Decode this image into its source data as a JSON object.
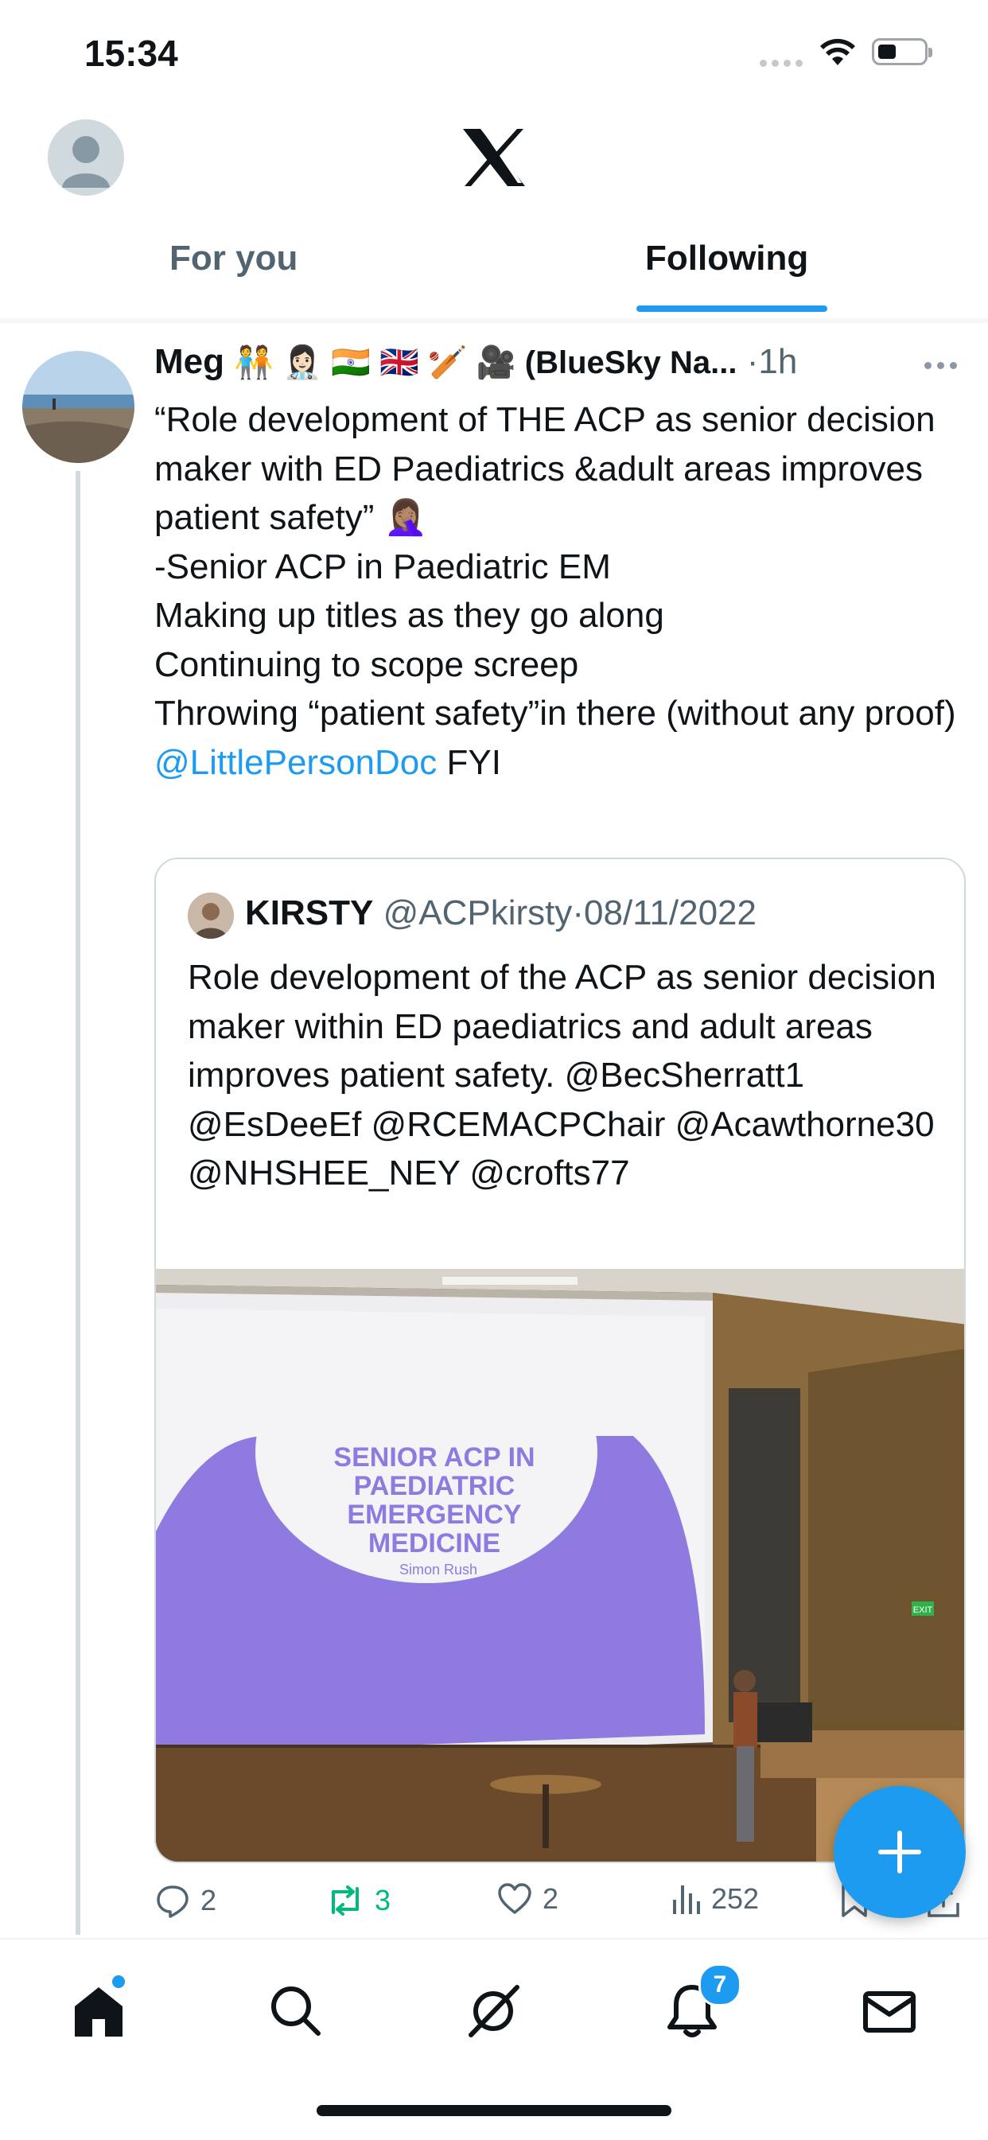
{
  "status_bar": {
    "time": "15:34"
  },
  "header": {
    "tabs": [
      {
        "label": "For you",
        "active": false
      },
      {
        "label": "Following",
        "active": true
      }
    ]
  },
  "tweet": {
    "name": "Meg",
    "name_suffix": "🧑‍🤝‍🧑 👩🏻‍⚕️ 🇮🇳 🇬🇧 🏏 🎥 (BlueSky Na...",
    "dot": "·",
    "time": "1h",
    "body_lines": [
      "“Role development of THE ACP as senior decision maker with ED Paediatrics &adult areas improves patient safety” 🤦🏽‍♀️",
      "-Senior ACP in Paediatric EM",
      "Making up titles as they go along",
      "Continuing to scope screep",
      "Throwing “patient safety”in there (without any proof)"
    ],
    "mention": "@LittlePersonDoc",
    "mention_suffix": " FYI",
    "quote": {
      "name": "KIRSTY",
      "handle": "@ACPkirsty",
      "dot": "·",
      "date": "08/11/2022",
      "body": "Role development of the ACP as senior decision maker within ED paediatrics and adult areas improves patient safety. @BecSherratt1 @EsDeeEf @RCEMACPChair @Acawthorne30 @NHSHEE_NEY @crofts77",
      "image": {
        "slide_title_lines": [
          "SENIOR ACP IN",
          "PAEDIATRIC",
          "EMERGENCY",
          "MEDICINE"
        ],
        "slide_subtitle": "Simon Rush",
        "exit_sign": "EXIT"
      }
    },
    "actions": {
      "replies": "2",
      "retweets": "3",
      "likes": "2",
      "views": "252"
    }
  },
  "nav": {
    "notifications_badge": "7"
  },
  "colors": {
    "accent": "#1d9bf0",
    "retweet_green": "#00ba7c",
    "slide_purple": "#8f7ae0"
  }
}
